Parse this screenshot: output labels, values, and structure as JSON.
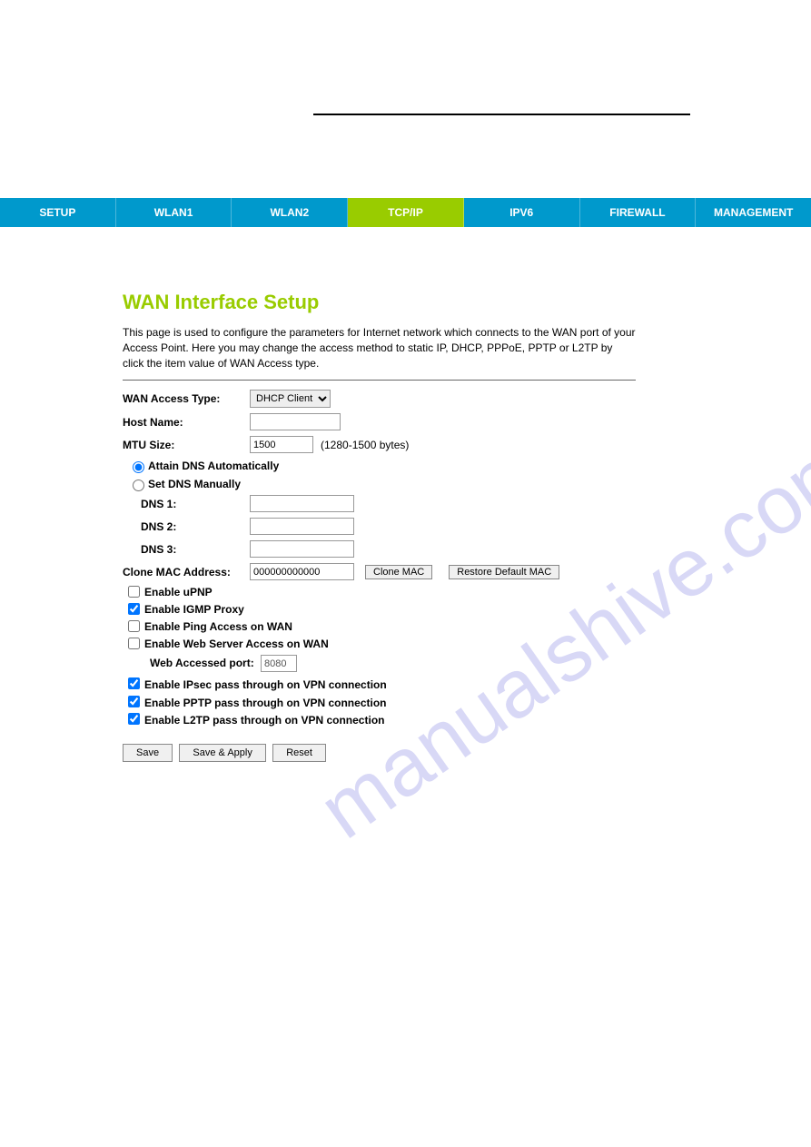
{
  "nav": {
    "tabs": [
      "SETUP",
      "WLAN1",
      "WLAN2",
      "TCP/IP",
      "IPV6",
      "FIREWALL",
      "MANAGEMENT"
    ],
    "active_index": 3
  },
  "page": {
    "title": "WAN Interface Setup",
    "intro": "This page is used to configure the parameters for Internet network which connects to the WAN port of your Access Point. Here you may change the access method to static IP, DHCP, PPPoE, PPTP or L2TP by click the item value of WAN Access type."
  },
  "form": {
    "wan_access_type_label": "WAN Access Type:",
    "wan_access_type_value": "DHCP Client",
    "host_name_label": "Host Name:",
    "host_name_value": "",
    "mtu_label": "MTU Size:",
    "mtu_value": "1500",
    "mtu_note": "(1280-1500 bytes)",
    "dns_auto_label": "Attain DNS Automatically",
    "dns_manual_label": "Set DNS Manually",
    "dns1_label": "DNS 1:",
    "dns2_label": "DNS 2:",
    "dns3_label": "DNS 3:",
    "dns1_value": "",
    "dns2_value": "",
    "dns3_value": "",
    "clone_mac_label": "Clone MAC Address:",
    "clone_mac_value": "000000000000",
    "clone_mac_btn": "Clone MAC",
    "restore_mac_btn": "Restore Default MAC",
    "enable_upnp": "Enable uPNP",
    "enable_igmp": "Enable IGMP Proxy",
    "enable_ping": "Enable Ping Access on WAN",
    "enable_web": "Enable Web Server Access on WAN",
    "web_port_label": "Web Accessed port:",
    "web_port_value": "8080",
    "enable_ipsec": "Enable IPsec pass through on VPN connection",
    "enable_pptp": "Enable PPTP pass through on VPN connection",
    "enable_l2tp": "Enable L2TP pass through on VPN connection",
    "save_btn": "Save",
    "save_apply_btn": "Save & Apply",
    "reset_btn": "Reset"
  },
  "watermark": "manualshive.com"
}
